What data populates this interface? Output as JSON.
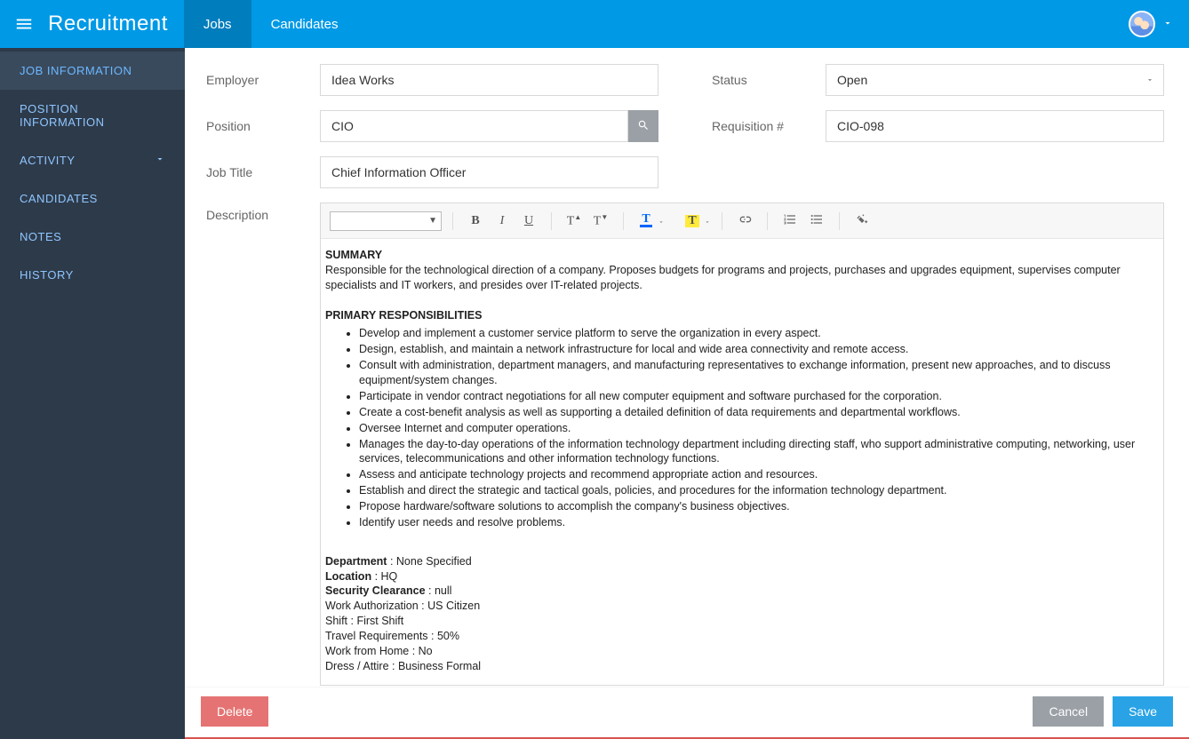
{
  "header": {
    "app_title": "Recruitment",
    "tabs": [
      {
        "label": "Jobs",
        "active": true
      },
      {
        "label": "Candidates",
        "active": false
      }
    ]
  },
  "sidebar": {
    "items": [
      {
        "label": "JOB INFORMATION",
        "active": true,
        "expandable": false
      },
      {
        "label": "POSITION INFORMATION",
        "active": false,
        "expandable": false
      },
      {
        "label": "ACTIVITY",
        "active": false,
        "expandable": true
      },
      {
        "label": "CANDIDATES",
        "active": false,
        "expandable": false
      },
      {
        "label": "NOTES",
        "active": false,
        "expandable": false
      },
      {
        "label": "HISTORY",
        "active": false,
        "expandable": false
      }
    ]
  },
  "form": {
    "employer": {
      "label": "Employer",
      "value": "Idea Works"
    },
    "status": {
      "label": "Status",
      "value": "Open"
    },
    "position": {
      "label": "Position",
      "value": "CIO"
    },
    "requisition": {
      "label": "Requisition #",
      "value": "CIO-098"
    },
    "job_title": {
      "label": "Job Title",
      "value": "Chief Information Officer"
    },
    "description_label": "Description"
  },
  "description": {
    "summary_heading": "SUMMARY",
    "summary_text": "Responsible for the technological direction of a company. Proposes budgets for programs and projects, purchases and upgrades equipment, supervises computer specialists and IT workers, and presides over IT-related projects.",
    "responsibilities_heading": "PRIMARY RESPONSIBILITIES",
    "responsibilities": [
      "Develop and implement a customer service platform to serve the organization in every aspect.",
      "Design, establish, and maintain a network infrastructure for local and wide area connectivity and remote access.",
      "Consult with administration, department managers, and manufacturing representatives to exchange information, present new approaches, and to discuss equipment/system changes.",
      "Participate in vendor contract negotiations for all new computer equipment and software purchased for the corporation.",
      "Create a cost-benefit analysis as well as supporting a detailed definition of data requirements and departmental workflows.",
      "Oversee Internet and computer operations.",
      "Manages the day-to-day operations of the information technology department including directing staff, who support administrative computing, networking, user services, telecommunications and other information technology functions.",
      "Assess and anticipate technology projects and recommend appropriate action and resources.",
      "Establish and direct the strategic and tactical goals, policies, and procedures for the information technology department.",
      "Propose hardware/software solutions to accomplish the company's business objectives.",
      "Identify user needs and resolve problems."
    ],
    "details": [
      {
        "label": "Department",
        "value": "None Specified",
        "bold_label": true
      },
      {
        "label": "Location",
        "value": "HQ",
        "bold_label": true
      },
      {
        "label": "Security Clearance",
        "value": "null",
        "bold_label": true
      },
      {
        "label": "Work Authorization",
        "value": "US Citizen",
        "bold_label": false
      },
      {
        "label": "Shift",
        "value": "First Shift",
        "bold_label": false
      },
      {
        "label": "Travel Requirements",
        "value": "50%",
        "bold_label": false
      },
      {
        "label": "Work from Home",
        "value": "No",
        "bold_label": false
      },
      {
        "label": "Dress / Attire",
        "value": "Business Formal",
        "bold_label": false
      }
    ]
  },
  "footer": {
    "delete": "Delete",
    "cancel": "Cancel",
    "save": "Save"
  }
}
